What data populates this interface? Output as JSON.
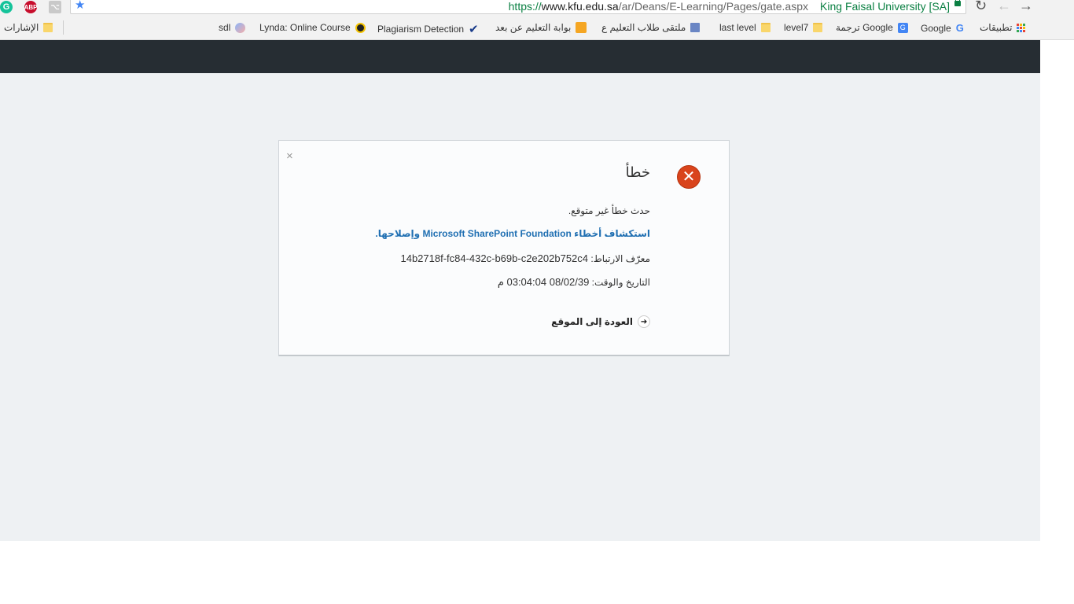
{
  "browser": {
    "url_scheme": "https://",
    "url_host": "www.kfu.edu.sa",
    "url_path": "/ar/Deans/E-Learning/Pages/gate.aspx",
    "site_identity": "King Faisal University [SA]",
    "ext_grammarly": "G",
    "ext_abp": "ABP"
  },
  "bookmarks": {
    "other": "الإشارات",
    "items": [
      {
        "label": "تطبيقات",
        "icon": "apps-icon"
      },
      {
        "label": "Google",
        "icon": "google-icon"
      },
      {
        "label": "ترجمة Google",
        "icon": "google-translate-icon"
      },
      {
        "label": "level7",
        "icon": "folder-icon"
      },
      {
        "label": "last level",
        "icon": "folder-icon"
      },
      {
        "label": "ملتقى طلاب التعليم ع",
        "icon": "page-icon"
      },
      {
        "label": "بوابة التعليم عن بعد",
        "icon": "orange-icon"
      },
      {
        "label": "Plagiarism Detection",
        "icon": "check-icon"
      },
      {
        "label": "Lynda: Online Course",
        "icon": "lynda-icon"
      },
      {
        "label": "sdl",
        "icon": "globe-icon"
      }
    ]
  },
  "dialog": {
    "close": "×",
    "title": "خطأ",
    "message": "حدث خطأ غير متوقع.",
    "troubleshoot_link": "استكشاف أخطاء Microsoft SharePoint Foundation وإصلاحها.",
    "correlation_label": "معرّف الارتباط:",
    "correlation_id": "14b2718f-fc84-432c-b69b-c2e202b752c4",
    "datetime_label": "التاريخ والوقت:",
    "datetime_value": "08/02/39 03:04:04 م",
    "back_link": "العودة إلى الموقع"
  },
  "colors": {
    "topbar": "#262d33",
    "page_background": "#eef1f3",
    "error_icon": "#d9441c",
    "link": "#1f6fb2"
  }
}
